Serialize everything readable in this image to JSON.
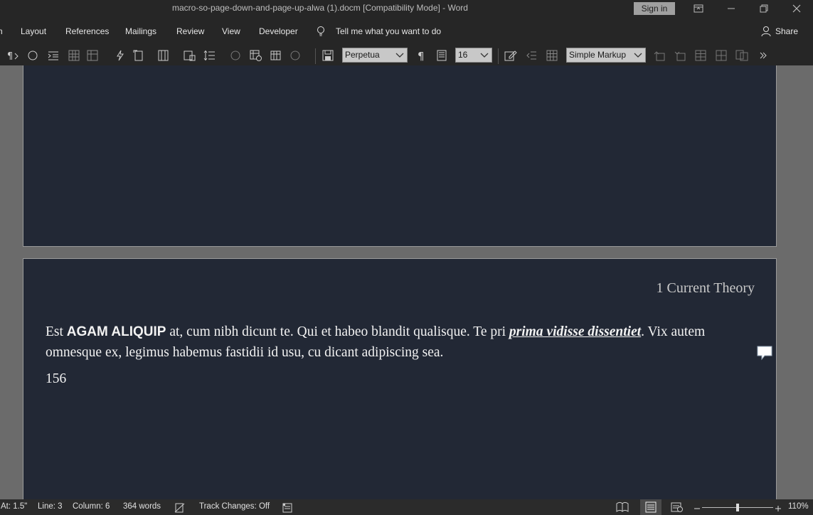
{
  "window": {
    "title": "macro-so-page-down-and-page-up-alwa (1).docm [Compatibility Mode]  -  Word",
    "sign_in": "Sign in"
  },
  "menu": {
    "items": [
      "Layout",
      "References",
      "Mailings",
      "Review",
      "View",
      "Developer"
    ],
    "tell_me": "Tell me what you want to do",
    "share": "Share"
  },
  "toolbar": {
    "font_name": "Perpetua",
    "font_size": "16",
    "markup_mode": "Simple Markup"
  },
  "document": {
    "header": "1 Current Theory",
    "para_start": "Est ",
    "para_caps": "AGAM ALIQUIP",
    "para_mid": " at, cum nibh dicunt te. Qui et habeo blandit qualisque. Te pri ",
    "para_italic": "prima vidisse dissentiet",
    "para_end": ". Vix autem omnesque ex, legimus habemus fastidii id usu, cu dicant adipiscing sea.",
    "number": "156"
  },
  "status": {
    "at": "At: 1.5\"",
    "line": "Line: 3",
    "column": "Column: 6",
    "words": "364 words",
    "track_changes": "Track Changes: Off",
    "zoom": "110%"
  },
  "colors": {
    "page_bg": "#222835",
    "chrome_bg": "#262626",
    "canvas_bg": "#6b6b6b"
  }
}
